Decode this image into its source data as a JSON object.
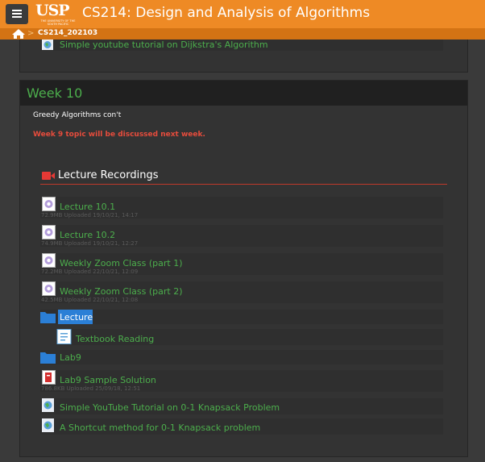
{
  "header": {
    "logo_text": "USP",
    "logo_subtitle": "THE UNIVERSITY OF THE SOUTH PACIFIC",
    "title": "CS214: Design and Analysis of Algorithms",
    "menu_icon": "hamburger-icon"
  },
  "breadcrumb": {
    "home_icon": "home-icon",
    "separator": ">",
    "course_code": "CS214_202103"
  },
  "previous_section": {
    "items": [
      {
        "title": "Simple youtube tutorial on Dijkstra's Algorithm",
        "icon": "url-globe-icon"
      }
    ]
  },
  "week": {
    "title": "Week 10",
    "description": "Greedy Algorithms con't",
    "note": "Week 9 topic will be discussed next week.",
    "section_title": "Lecture Recordings",
    "section_icon": "video-camera-icon",
    "items": [
      {
        "title": "Lecture 10.1",
        "meta": "72.9MB Uploaded 19/10/21, 14:17",
        "icon": "video-file-icon"
      },
      {
        "title": "Lecture 10.2",
        "meta": "74.9MB Uploaded 19/10/21, 12:27",
        "icon": "video-file-icon"
      },
      {
        "title": "Weekly Zoom Class (part 1)",
        "meta": "72.2MB Uploaded 22/10/21, 12:09",
        "icon": "video-file-icon"
      },
      {
        "title": "Weekly Zoom Class (part 2)",
        "meta": "42.5MB Uploaded 22/10/21, 12:08",
        "icon": "video-file-icon"
      },
      {
        "title": "Lecture",
        "meta": "",
        "icon": "folder-icon"
      },
      {
        "title": "Textbook Reading",
        "meta": "",
        "icon": "page-icon"
      },
      {
        "title": "Lab9",
        "meta": "",
        "icon": "folder-icon"
      },
      {
        "title": "Lab9 Sample Solution",
        "meta": "786.8KB Uploaded 25/09/18, 12:51",
        "icon": "pdf-file-icon"
      },
      {
        "title": "Simple YouTube Tutorial on 0-1 Knapsack Problem",
        "meta": "",
        "icon": "url-globe-icon"
      },
      {
        "title": "A Shortcut method for 0-1 Knapsack problem",
        "meta": "",
        "icon": "url-globe-icon"
      }
    ]
  },
  "colors": {
    "header_orange": "#ee8a25",
    "breadcrumb_orange": "#d37314",
    "link_green": "#4cae4c",
    "alert_red": "#e74c3c",
    "selection_blue": "#2b7fd6"
  }
}
